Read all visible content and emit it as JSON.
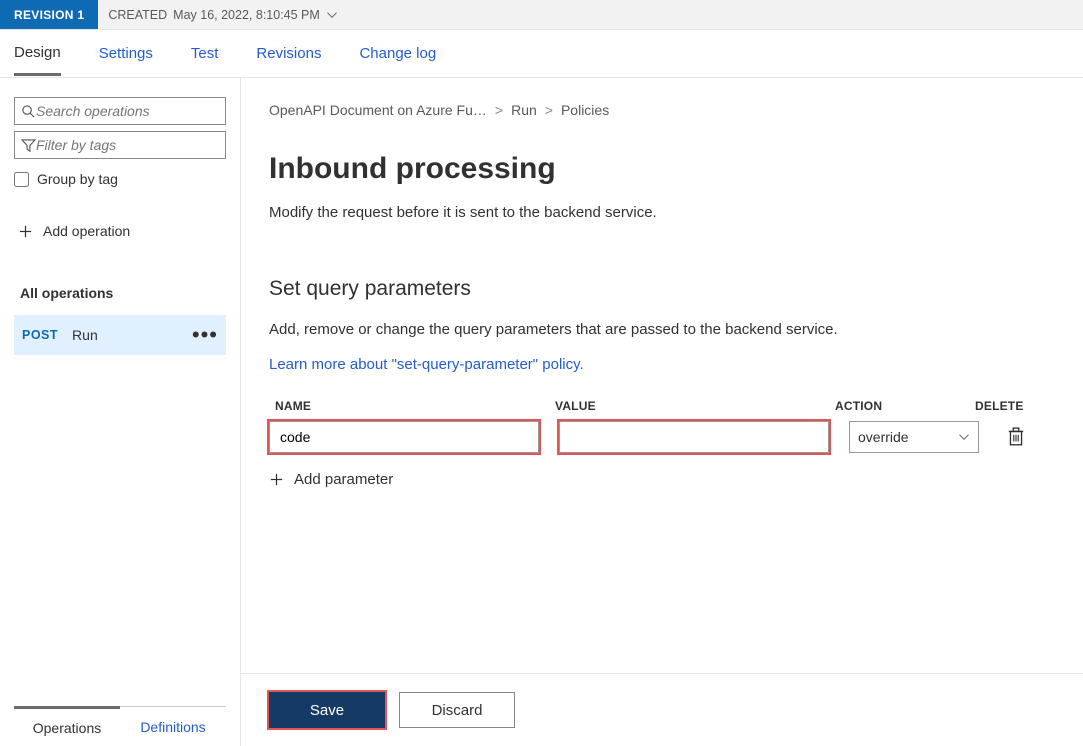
{
  "revision": {
    "badge": "REVISION 1",
    "created_label": "CREATED",
    "created_ts": "May 16, 2022, 8:10:45 PM"
  },
  "tabs": {
    "design": "Design",
    "settings": "Settings",
    "test": "Test",
    "revisions": "Revisions",
    "changelog": "Change log"
  },
  "sidebar": {
    "search_placeholder": "Search operations",
    "filter_placeholder": "Filter by tags",
    "group_by_tag": "Group by tag",
    "add_operation": "Add operation",
    "all_operations": "All operations",
    "operation": {
      "method": "POST",
      "name": "Run"
    },
    "bottom": {
      "operations": "Operations",
      "definitions": "Definitions"
    }
  },
  "breadcrumb": {
    "a": "OpenAPI Document on Azure Fu…",
    "b": "Run",
    "c": "Policies"
  },
  "page": {
    "h1": "Inbound processing",
    "subtitle": "Modify the request before it is sent to the backend service.",
    "h2": "Set query parameters",
    "desc": "Add, remove or change the query parameters that are passed to the backend service.",
    "learn": "Learn more about \"set-query-parameter\" policy."
  },
  "table": {
    "head": {
      "name": "NAME",
      "value": "VALUE",
      "action": "ACTION",
      "delete": "DELETE"
    },
    "row": {
      "name": "code",
      "value": "",
      "action": "override"
    },
    "add_param": "Add parameter"
  },
  "buttons": {
    "save": "Save",
    "discard": "Discard"
  }
}
